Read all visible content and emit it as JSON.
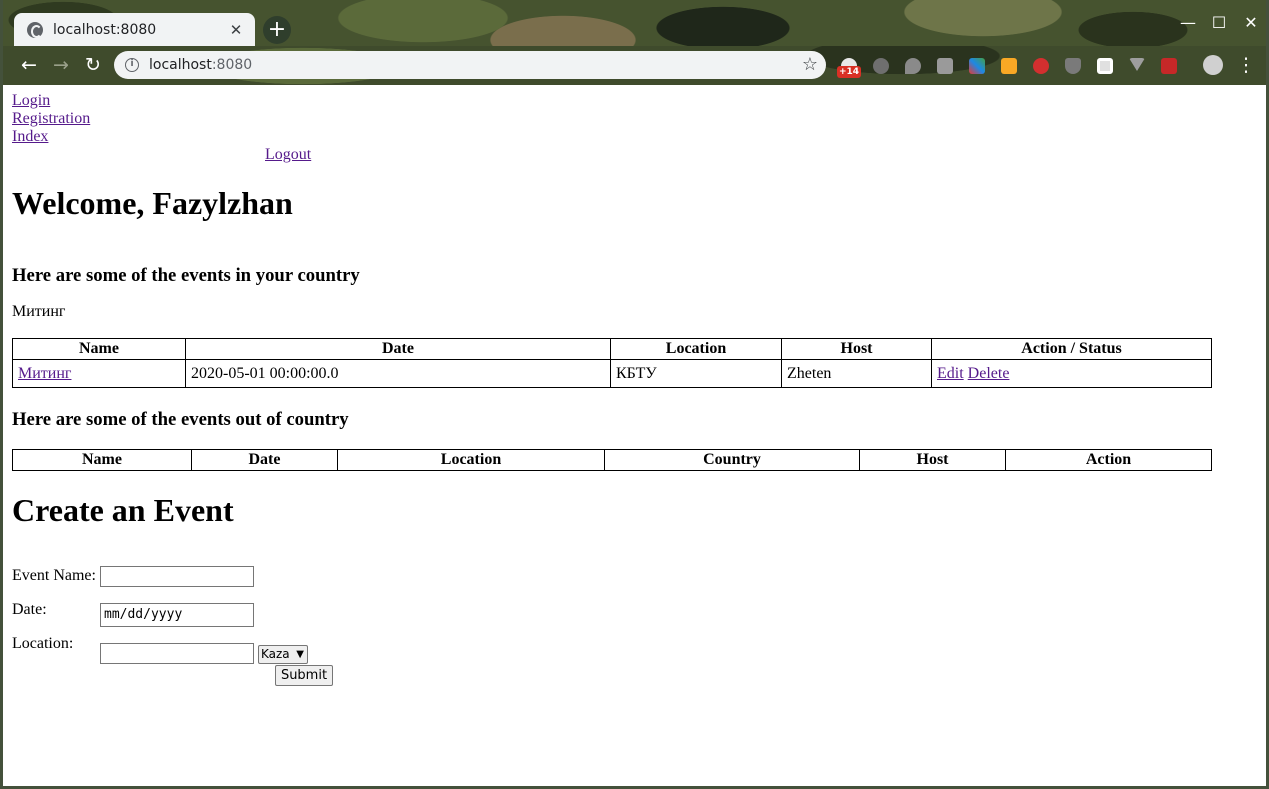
{
  "browser": {
    "tab_title": "localhost:8080",
    "tab_close": "✕",
    "new_tab": "+",
    "url_host": "localhost",
    "url_port": ":8080",
    "extension_badge": "+14"
  },
  "nav": {
    "login": "Login",
    "registration": "Registration",
    "index": "Index",
    "logout": "Logout"
  },
  "welcome": "Welcome, Fazylzhan",
  "in_country": {
    "heading": "Here are some of the events in your country",
    "country_label": "Митинг",
    "columns": [
      "Name",
      "Date",
      "Location",
      "Host",
      "Action / Status"
    ],
    "rows": [
      {
        "name": "Митинг",
        "date": "2020-05-01 00:00:00.0",
        "location": "КБТУ",
        "host": "Zheten",
        "edit": "Edit",
        "delete": "Delete"
      }
    ]
  },
  "out_country": {
    "heading": "Here are some of the events out of country",
    "columns": [
      "Name",
      "Date",
      "Location",
      "Country",
      "Host",
      "Action"
    ]
  },
  "create": {
    "title": "Create an Event",
    "event_name_label": "Event Name:",
    "date_label": "Date:",
    "date_placeholder": "mm/dd/yyyy",
    "location_label": "Location:",
    "country_selected": "Kaza",
    "submit": "Submit"
  }
}
